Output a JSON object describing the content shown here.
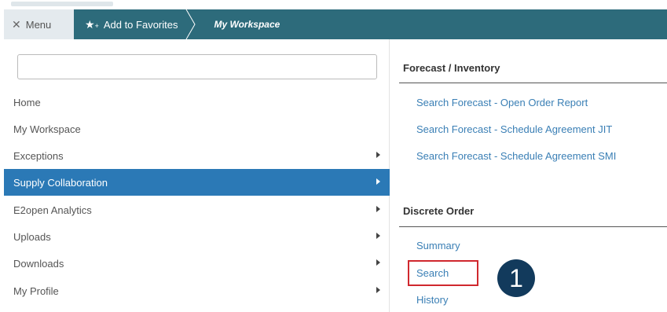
{
  "toolbar": {
    "menu_label": "Menu",
    "menu_icon": "close-icon",
    "favorites_label": "Add to Favorites",
    "favorites_icon": "star-plus-icon",
    "breadcrumb": "My Workspace"
  },
  "search": {
    "placeholder": "",
    "value": ""
  },
  "nav": {
    "items": [
      {
        "label": "Home",
        "has_submenu": false,
        "active": false
      },
      {
        "label": "My Workspace",
        "has_submenu": false,
        "active": false
      },
      {
        "label": "Exceptions",
        "has_submenu": true,
        "active": false
      },
      {
        "label": "Supply Collaboration",
        "has_submenu": true,
        "active": true
      },
      {
        "label": "E2open Analytics",
        "has_submenu": true,
        "active": false
      },
      {
        "label": "Uploads",
        "has_submenu": true,
        "active": false
      },
      {
        "label": "Downloads",
        "has_submenu": true,
        "active": false
      },
      {
        "label": "My Profile",
        "has_submenu": true,
        "active": false
      }
    ]
  },
  "sections": [
    {
      "title": "Forecast / Inventory",
      "links": [
        "Search Forecast - Open Order Report",
        "Search Forecast - Schedule Agreement JIT",
        "Search Forecast - Schedule Agreement SMI"
      ]
    },
    {
      "title": "Discrete Order",
      "links": [
        "Summary",
        "Search",
        "History"
      ]
    }
  ],
  "annotation": {
    "step_number": "1",
    "highlighted_link": "Search"
  },
  "colors": {
    "toolbar_bg": "#2d6b7b",
    "active_item_bg": "#2b79b6",
    "link": "#3a7fb5",
    "highlight_border": "#d0282e",
    "badge_bg": "#123a5c"
  }
}
